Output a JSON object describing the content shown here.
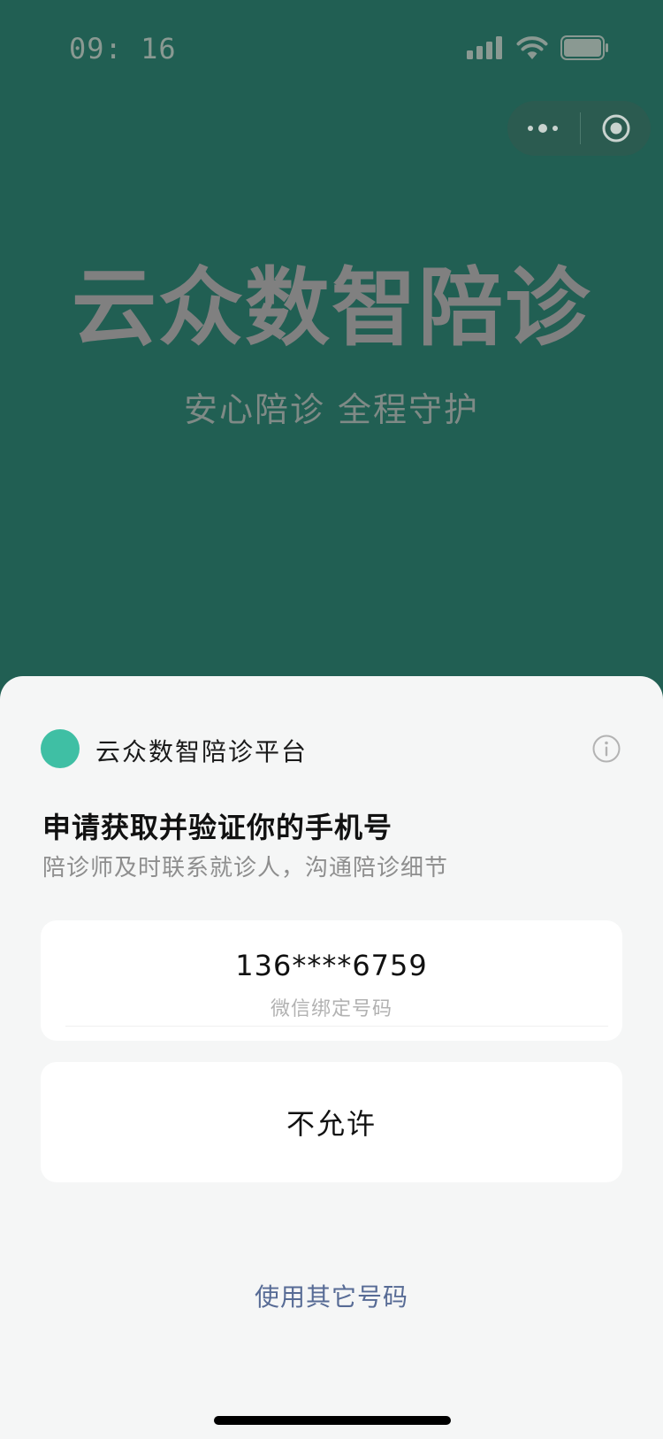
{
  "status_bar": {
    "time": "09: 16",
    "icons": [
      "signal-icon",
      "wifi-icon",
      "battery-icon"
    ]
  },
  "capsule": {
    "icons": [
      "more-dots-icon",
      "close-target-icon"
    ]
  },
  "hero": {
    "title": "云众数智陪诊",
    "subtitle": "安心陪诊 全程守护"
  },
  "sheet": {
    "app_name": "云众数智陪诊平台",
    "title": "申请获取并验证你的手机号",
    "description": "陪诊师及时联系就诊人，沟通陪诊细节",
    "phone_option": {
      "number": "136****6759",
      "label": "微信绑定号码"
    },
    "deny_label": "不允许",
    "other_number_label": "使用其它号码"
  },
  "colors": {
    "background": "#215f53",
    "logo": "#3fbfa4",
    "link": "#576b95",
    "sheet": "#f5f6f6"
  }
}
